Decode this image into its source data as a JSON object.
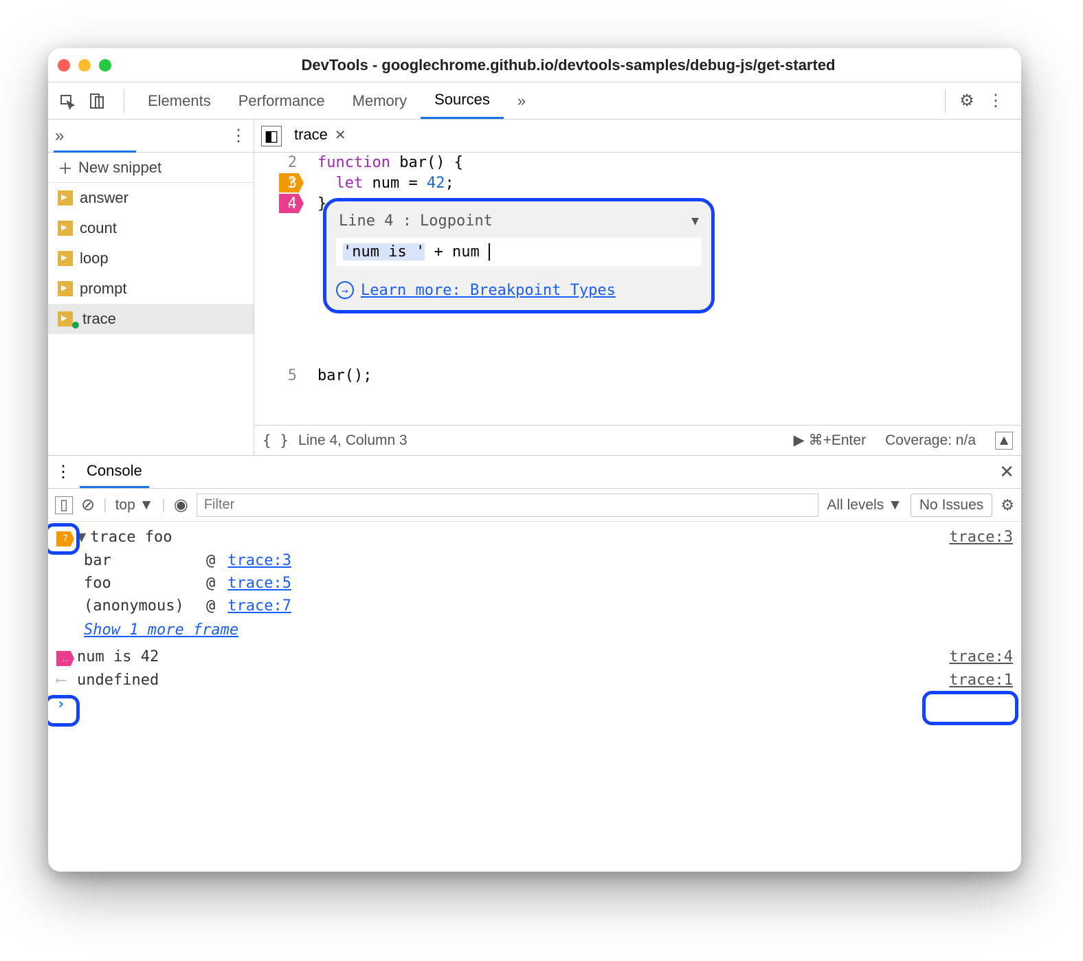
{
  "window": {
    "title": "DevTools - googlechrome.github.io/devtools-samples/debug-js/get-started"
  },
  "tabs": {
    "elements": "Elements",
    "performance": "Performance",
    "memory": "Memory",
    "sources": "Sources",
    "more": "»"
  },
  "sidebar": {
    "more": "»",
    "new_snippet": "New snippet",
    "files": [
      "answer",
      "count",
      "loop",
      "prompt",
      "trace"
    ],
    "selected": "trace"
  },
  "editor": {
    "tab_name": "trace",
    "lines": [
      {
        "n": 2,
        "html": "<span class='kw'>function</span> bar<span class='fn'>()</span> {"
      },
      {
        "n": 3,
        "html": "  <span class='let'>let</span> num = <span class='num'>42</span>;",
        "bp": "orange",
        "bpglyph": "?"
      },
      {
        "n": 4,
        "html": "}",
        "bp": "pink",
        "bpglyph": "‥"
      },
      {
        "n": 5,
        "html": "bar();"
      }
    ],
    "status": {
      "pretty": "{ }",
      "pos": "Line 4, Column 3",
      "run": "▶ ⌘+Enter",
      "coverage": "Coverage: n/a"
    }
  },
  "popup": {
    "line_label": "Line 4 :",
    "kind": "Logpoint",
    "expr_prefix": "'num is '",
    "expr_suffix": " + num",
    "learn": "Learn more: Breakpoint Types"
  },
  "console": {
    "tab": "Console",
    "context": "top ▼",
    "filter_placeholder": "Filter",
    "levels": "All levels ▼",
    "issues": "No Issues",
    "rows": {
      "trace_header": "trace foo",
      "trace_src": "trace:3",
      "stack": [
        {
          "fn": "bar",
          "at": "@",
          "link": "trace:3"
        },
        {
          "fn": "foo",
          "at": "@",
          "link": "trace:5"
        },
        {
          "fn": "(anonymous)",
          "at": "@",
          "link": "trace:7"
        }
      ],
      "show_more": "Show 1 more frame",
      "log_msg": "num is 42",
      "log_src": "trace:4",
      "undef": "undefined",
      "undef_src": "trace:1"
    }
  }
}
